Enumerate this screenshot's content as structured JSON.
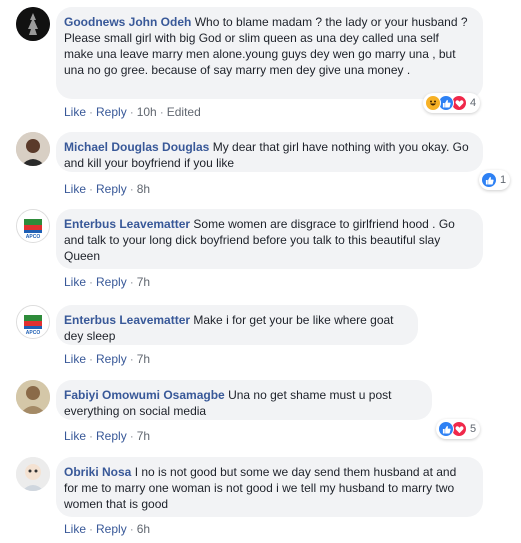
{
  "actions": {
    "like": "Like",
    "reply": "Reply",
    "sep": "·"
  },
  "comments": [
    {
      "author": "Goodnews John Odeh",
      "text": "Who to blame madam ? the lady or your husband ? Please small girl with big God or slim queen as una dey called una self make una leave marry men alone.young guys dey wen go marry una , but una no go gree. because of say marry men dey give una money .",
      "time": "10h",
      "edited": "Edited",
      "reactions": [
        "haha",
        "like",
        "love"
      ],
      "reaction_count": "4"
    },
    {
      "author": "Michael Douglas Douglas",
      "text": "My dear that girl have nothing with you okay. Go and kill your boyfriend if you like",
      "time": "8h",
      "reactions": [
        "like"
      ],
      "reaction_count": "1"
    },
    {
      "author": "Enterbus Leavematter",
      "text": "Some women are disgrace to girlfriend hood . Go and talk to your long dick boyfriend before you talk to this beautiful slay Queen",
      "time": "7h",
      "avatar_label": "APCO"
    },
    {
      "author": "Enterbus Leavematter",
      "text": "Make i for get your be like where goat dey sleep",
      "time": "7h",
      "avatar_label": "APCO"
    },
    {
      "author": "Fabiyi Omowumi Osamagbe",
      "text": "Una no get shame must u post everything on social media",
      "time": "7h",
      "reactions": [
        "like",
        "love"
      ],
      "reaction_count": "5"
    },
    {
      "author": "Obriki Nosa",
      "text": "I no is not good but some we day send them husband at and for me to marry one woman is not good i we tell my husband to marry two women that is good",
      "time": "6h"
    }
  ]
}
